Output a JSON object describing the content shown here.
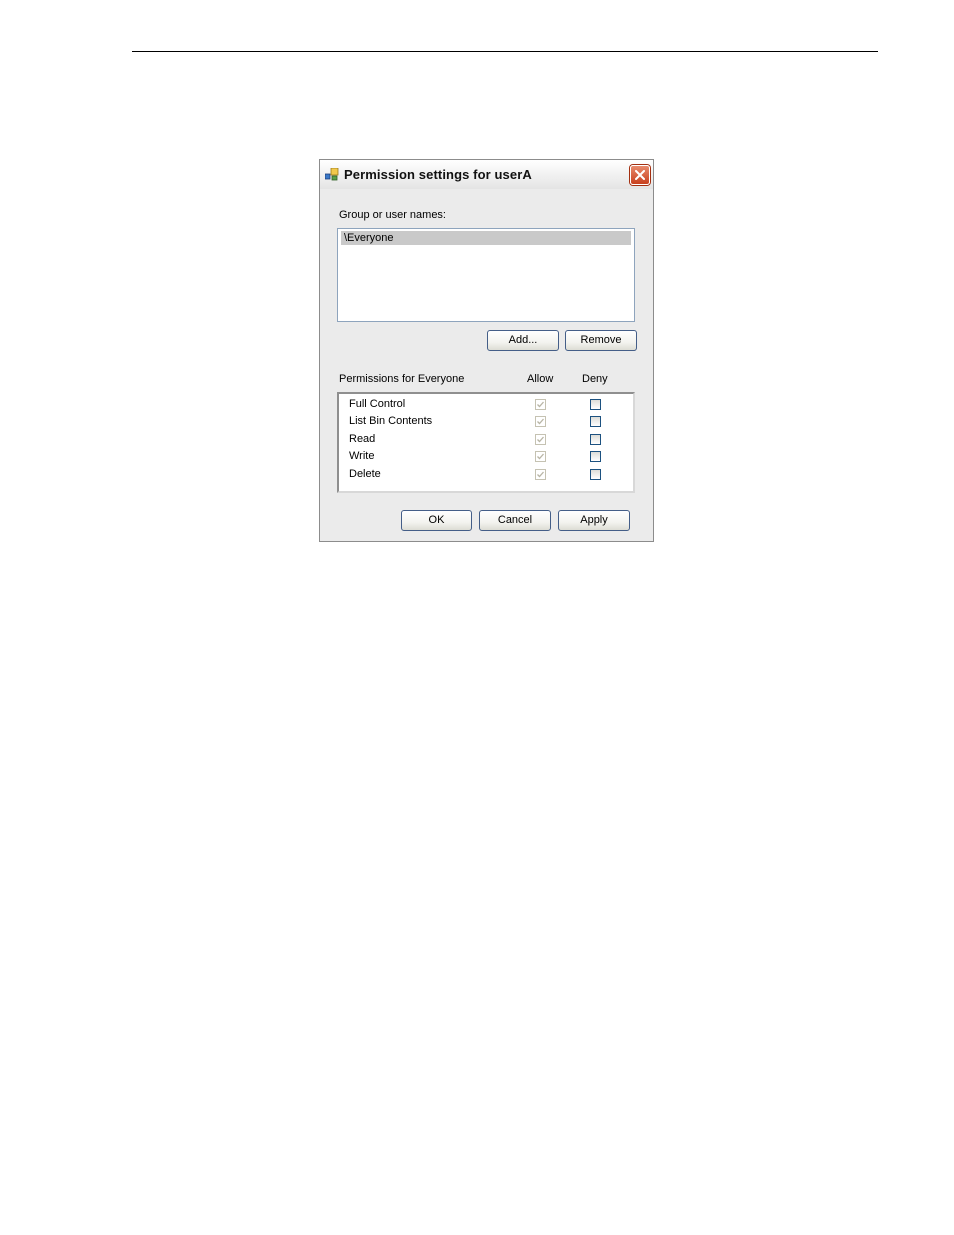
{
  "dialog": {
    "title": "Permission settings for userA",
    "group_label": "Group or user names:",
    "users": [
      {
        "name": "\\Everyone",
        "selected": true
      }
    ],
    "add_label": "Add...",
    "remove_label": "Remove",
    "permissions_label": "Permissions for Everyone",
    "allow_header": "Allow",
    "deny_header": "Deny",
    "permissions": [
      {
        "name": "Full Control",
        "allow": true,
        "deny": false
      },
      {
        "name": "List Bin Contents",
        "allow": true,
        "deny": false
      },
      {
        "name": "Read",
        "allow": true,
        "deny": false
      },
      {
        "name": "Write",
        "allow": true,
        "deny": false
      },
      {
        "name": "Delete",
        "allow": true,
        "deny": false
      }
    ],
    "ok_label": "OK",
    "cancel_label": "Cancel",
    "apply_label": "Apply"
  },
  "icons": {
    "title": "permissions-app-icon",
    "close": "close-icon",
    "check": "checkmark-icon"
  },
  "colors": {
    "close_button": "#c8401e",
    "selection": "#c9c9c9",
    "checkbox_border": "#1c5180"
  }
}
